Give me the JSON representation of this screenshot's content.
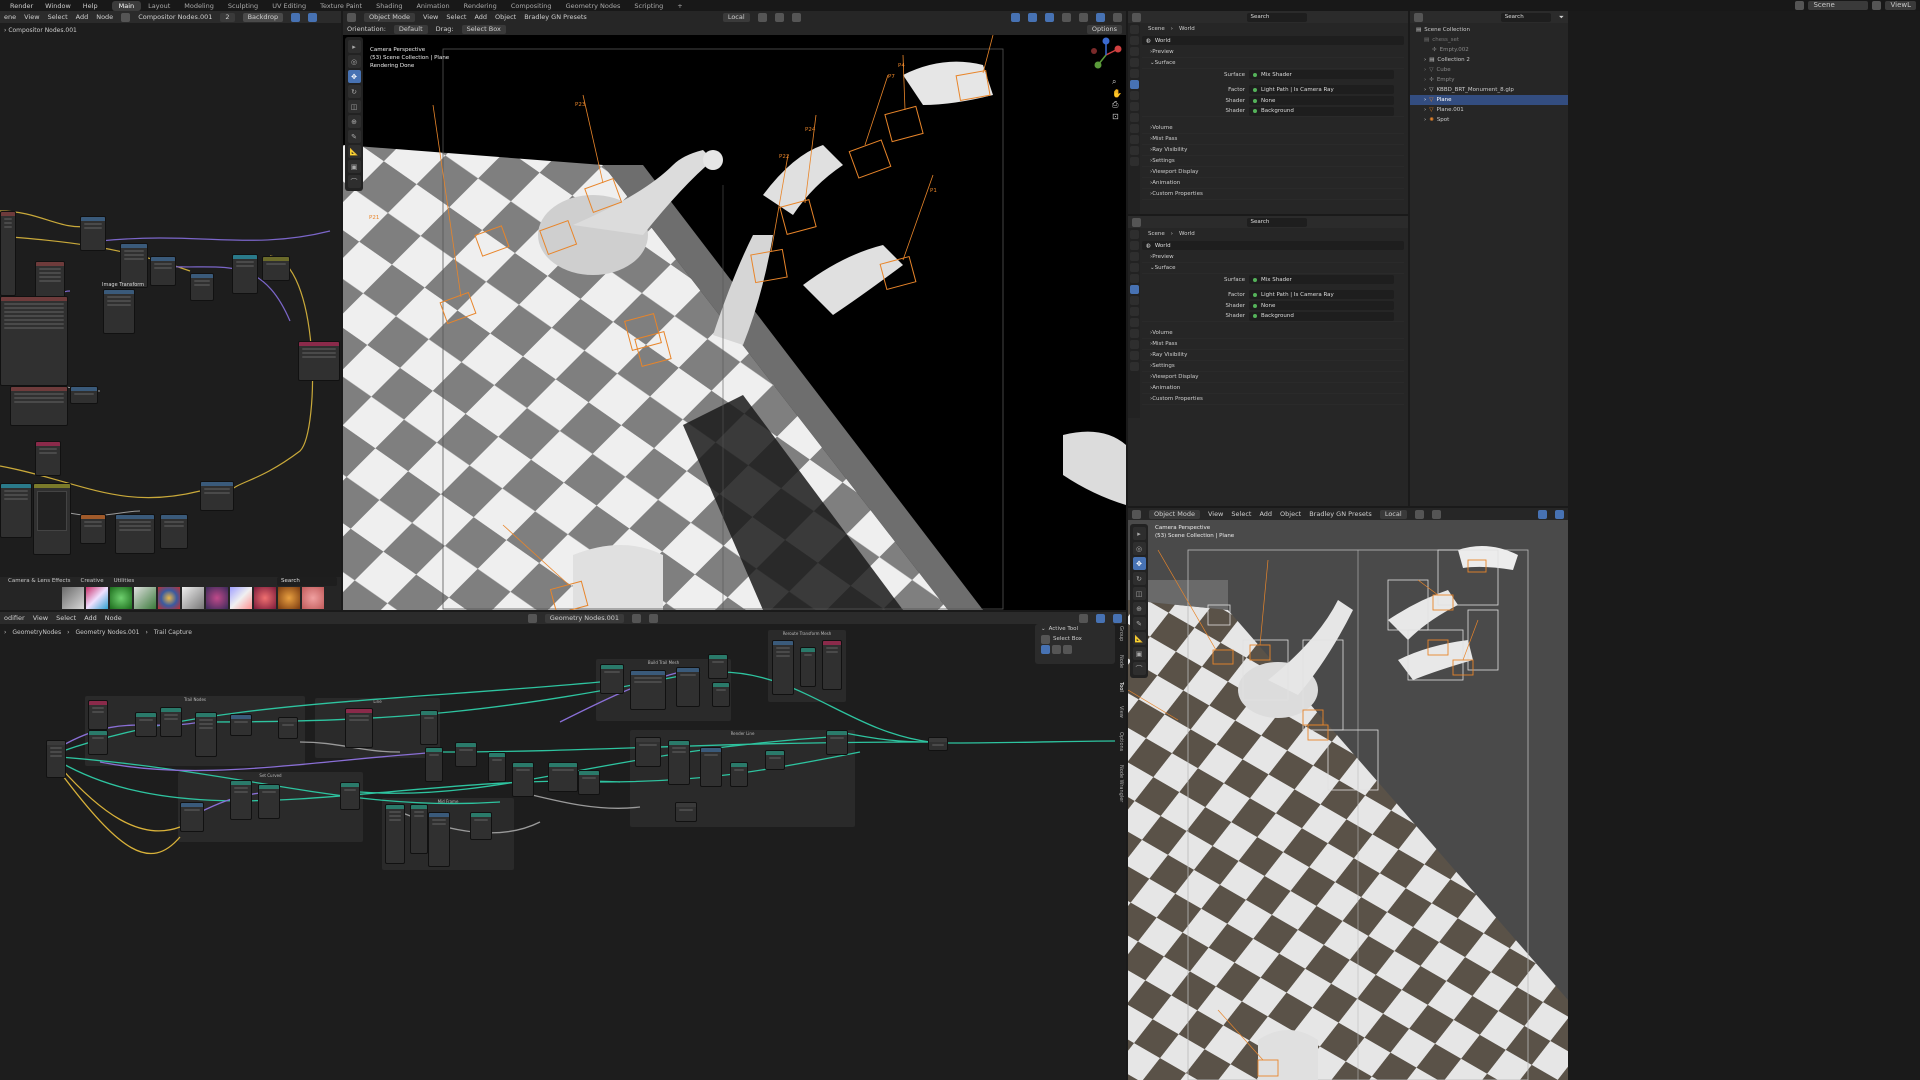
{
  "topbar": {
    "menus": [
      "Render",
      "Window",
      "Help"
    ],
    "workspaces": [
      "Main",
      "Layout",
      "Modeling",
      "Sculpting",
      "UV Editing",
      "Texture Paint",
      "Shading",
      "Animation",
      "Rendering",
      "Compositing",
      "Geometry Nodes",
      "Scripting",
      "+"
    ],
    "active_workspace": "Main",
    "scene_label": "Scene",
    "viewlayer_label": "ViewL"
  },
  "compositor": {
    "header_items": [
      "ene",
      "View",
      "Select",
      "Add",
      "Node"
    ],
    "tree_name": "Compositor Nodes.001",
    "user_count": "2",
    "backdrop_label": "Backdrop",
    "breadcrumb": "Compositor Nodes.001",
    "node_label_image_transform": "Image Transform",
    "asset_tabs": [
      "Camera & Lens Effects",
      "Creative",
      "Utilities"
    ],
    "asset_search_placeholder": "Search"
  },
  "viewport_main": {
    "mode": "Object Mode",
    "menus": [
      "View",
      "Select",
      "Add",
      "Object",
      "Bradley GN Presets"
    ],
    "transform": "Local",
    "orientation_label": "Orientation:",
    "orientation_value": "Default",
    "drag_label": "Drag:",
    "drag_value": "Select Box",
    "options_label": "Options",
    "overlay_line1": "Camera Perspective",
    "overlay_line2": "(53) Scene Collection | Plane",
    "overlay_line3": "Rendering Done",
    "point_labels": [
      "P23",
      "P24",
      "P22",
      "P7",
      "P4",
      "P1",
      "P21"
    ]
  },
  "properties_top": {
    "search_placeholder": "Search",
    "breadcrumb": [
      "Scene",
      "World"
    ],
    "world_name": "World",
    "sections": [
      "Preview",
      "Surface"
    ],
    "surface_label": "Surface",
    "surface_value": "Mix Shader",
    "factor_label": "Factor",
    "factor_value": "Light Path | Is Camera Ray",
    "shader1_label": "Shader",
    "shader1_value": "None",
    "shader2_label": "Shader",
    "shader2_value": "Background",
    "collapsed_sections": [
      "Volume",
      "Mist Pass",
      "Ray Visibility",
      "Settings",
      "Viewport Display",
      "Animation",
      "Custom Properties"
    ]
  },
  "properties_bottom": {
    "search_placeholder": "Search",
    "breadcrumb": [
      "Scene",
      "World"
    ],
    "world_name": "World",
    "sections": [
      "Preview",
      "Surface"
    ],
    "surface_label": "Surface",
    "surface_value": "Mix Shader",
    "factor_label": "Factor",
    "factor_value": "Light Path | Is Camera Ray",
    "shader1_label": "Shader",
    "shader1_value": "None",
    "shader2_label": "Shader",
    "shader2_value": "Background",
    "collapsed_sections": [
      "Volume",
      "Mist Pass",
      "Ray Visibility",
      "Settings",
      "Viewport Display",
      "Animation",
      "Custom Properties"
    ]
  },
  "outliner": {
    "search_placeholder": "Search",
    "scene_label": "Scene",
    "items": [
      {
        "label": "Scene Collection",
        "depth": 0,
        "selected": false
      },
      {
        "label": "chess_set",
        "depth": 1,
        "selected": false
      },
      {
        "label": "Empty.002",
        "depth": 2,
        "selected": false
      },
      {
        "label": "Collection 2",
        "depth": 1,
        "selected": false
      },
      {
        "label": "Cube",
        "depth": 1,
        "selected": false
      },
      {
        "label": "Empty",
        "depth": 1,
        "selected": false
      },
      {
        "label": "KBBD_BRT_Monument_8.glp",
        "depth": 1,
        "selected": false
      },
      {
        "label": "Plane",
        "depth": 1,
        "selected": true
      },
      {
        "label": "Plane.001",
        "depth": 1,
        "selected": false
      },
      {
        "label": "Spot",
        "depth": 1,
        "selected": false
      }
    ]
  },
  "geonodes": {
    "header_items": [
      "odifier",
      "View",
      "Select",
      "Add",
      "Node"
    ],
    "tree_name": "Geometry Nodes.001",
    "breadcrumb": [
      "GeometryNodes",
      "Geometry Nodes.001",
      "Trail Capture"
    ],
    "frame_labels": [
      "Trail Nodes",
      "Line",
      "Build Trail Mesh",
      "Reroute Transform Mesh",
      "Render Line",
      "Set Curved",
      "Mid Frame"
    ],
    "active_tool_title": "Active Tool",
    "active_tool_value": "Select Box",
    "side_tabs": [
      "Group",
      "Node",
      "Tool",
      "View",
      "Options",
      "Node Wrangler"
    ]
  },
  "viewport_secondary": {
    "mode": "Object Mode",
    "menus": [
      "View",
      "Select",
      "Add",
      "Object",
      "Bradley GN Presets"
    ],
    "transform": "Local",
    "overlay_line1": "Camera Perspective",
    "overlay_line2": "(53) Scene Collection | Plane"
  },
  "colors": {
    "accent_blue": "#4772b3",
    "annotation_orange": "#e8852a",
    "socket_green": "#2ec4a0",
    "socket_purple": "#8a6fd6",
    "wire_yellow": "#d9b23a"
  }
}
